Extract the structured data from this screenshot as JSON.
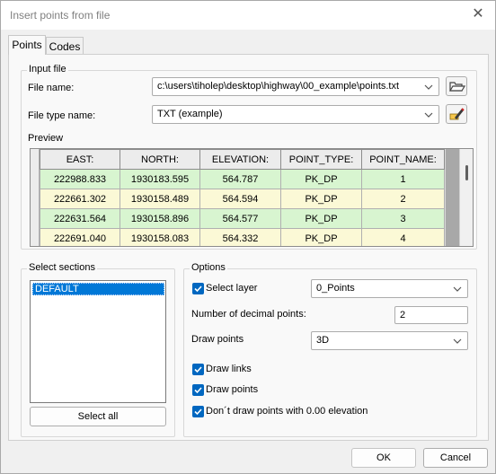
{
  "window": {
    "title": "Insert points from file",
    "close_glyph": "✕"
  },
  "tabs": [
    {
      "label": "Points"
    },
    {
      "label": "Codes"
    }
  ],
  "input_file": {
    "group_label": "Input file",
    "file_name_label": "File name:",
    "file_name_value": "c:\\users\\tiholep\\desktop\\highway\\00_example\\points.txt",
    "file_type_label": "File type name:",
    "file_type_value": "TXT (example)",
    "browse_icon": "folder-open-icon",
    "edit_icon": "edit-pencil-icon"
  },
  "preview": {
    "label": "Preview",
    "columns": [
      "EAST:",
      "NORTH:",
      "ELEVATION:",
      "POINT_TYPE:",
      "POINT_NAME:"
    ],
    "rows": [
      [
        "222988.833",
        "1930183.595",
        "564.787",
        "PK_DP",
        "1"
      ],
      [
        "222661.302",
        "1930158.489",
        "564.594",
        "PK_DP",
        "2"
      ],
      [
        "222631.564",
        "1930158.896",
        "564.577",
        "PK_DP",
        "3"
      ],
      [
        "222691.040",
        "1930158.083",
        "564.332",
        "PK_DP",
        "4"
      ]
    ],
    "row_colors": [
      "#d8f5d0",
      "#fbf9d6"
    ]
  },
  "sections": {
    "group_label": "Select sections",
    "items": [
      "DEFAULT"
    ],
    "select_all_label": "Select all"
  },
  "options": {
    "group_label": "Options",
    "select_layer_label": "Select layer",
    "select_layer_checked": true,
    "layer_value": "0_Points",
    "decimal_points_label": "Number of decimal points:",
    "decimal_points_value": "2",
    "draw_points_mode_label": "Draw points",
    "draw_points_mode_value": "3D",
    "draw_links_label": "Draw links",
    "draw_links_checked": true,
    "draw_points_label": "Draw points",
    "draw_points_checked": true,
    "skip_zero_label": "Don´t draw points with 0.00 elevation",
    "skip_zero_checked": true
  },
  "footer": {
    "ok_label": "OK",
    "cancel_label": "Cancel"
  },
  "colors": {
    "accent": "#0067c0",
    "selection": "#0078d7"
  }
}
